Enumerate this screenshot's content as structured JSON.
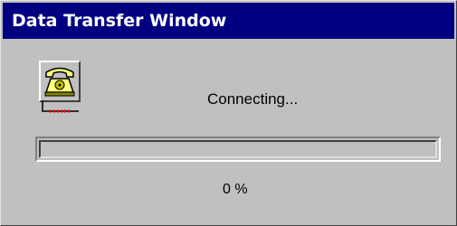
{
  "window": {
    "title": "Data Transfer Window",
    "title_bar_color": "#000080",
    "face_color": "#c0c0c0"
  },
  "status": {
    "icon": "telephone-icon",
    "text": "Connecting..."
  },
  "progress": {
    "fraction": 0,
    "label": "0 %",
    "fill_color": "#000080"
  }
}
